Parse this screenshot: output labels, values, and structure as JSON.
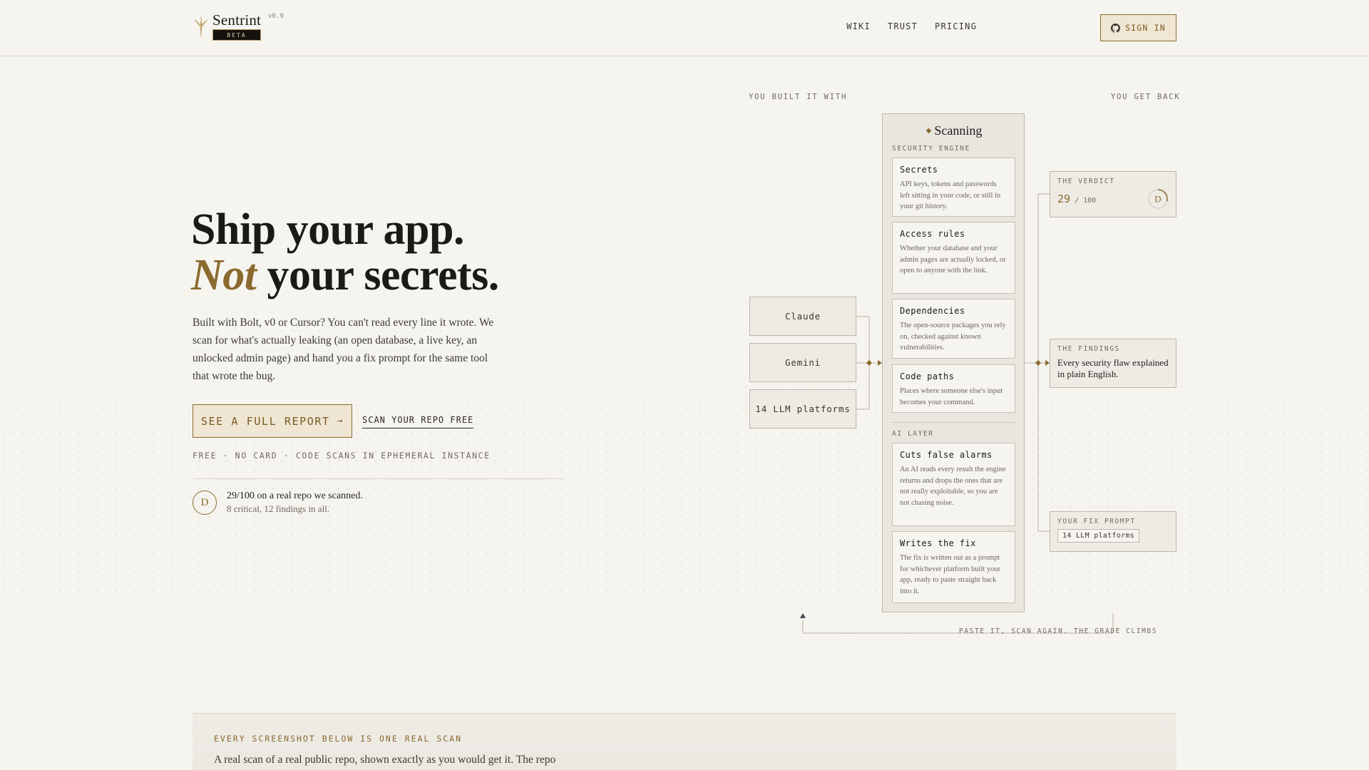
{
  "brand": {
    "name": "Sentrint",
    "version": "v0.9",
    "badge": "BETA"
  },
  "nav": {
    "items": [
      "WIKI",
      "TRUST",
      "PRICING"
    ],
    "signin_label": "SIGN IN"
  },
  "hero": {
    "headline_line1": "Ship your app.",
    "headline_emph": "Not",
    "headline_line2_rest": " your secrets.",
    "lead": "Built with Bolt, v0 or Cursor? You can't read every line it wrote. We scan for what's actually leaking (an open database, a live key, an unlocked admin page) and hand you a fix prompt for the same tool that wrote the bug.",
    "cta_primary": "SEE A FULL REPORT",
    "cta_primary_arrow": "→",
    "cta_secondary": "SCAN YOUR REPO FREE",
    "smallprint": "FREE · NO CARD · CODE SCANS IN EPHEMERAL INSTANCE",
    "grade_letter": "D",
    "grade_score": "29/100",
    "grade_text": " on a real repo we scanned.",
    "grade_detail": "8 critical, 12 findings in all."
  },
  "diagram": {
    "left_label": "YOU BUILT IT WITH",
    "right_label": "YOU GET BACK",
    "sources": [
      "Claude",
      "Gemini",
      "14 LLM platforms"
    ],
    "engine": {
      "title": "Scanning",
      "section1": "SECURITY ENGINE",
      "section2": "AI LAYER",
      "cards": [
        {
          "title": "Secrets",
          "text": "API keys, tokens and passwords left sitting in your code, or still in your git history."
        },
        {
          "title": "Access rules",
          "text": "Whether your database and your admin pages are actually locked, or open to anyone with the link."
        },
        {
          "title": "Dependencies",
          "text": "The open-source packages you rely on, checked against known vulnerabilities."
        },
        {
          "title": "Code paths",
          "text": "Places where someone else's input becomes your command."
        },
        {
          "title": "Cuts false alarms",
          "text": "An AI reads every result the engine returns and drops the ones that are not really exploitable, so you are not chasing noise."
        },
        {
          "title": "Writes the fix",
          "text": "The fix is written out as a prompt for whichever platform built your app, ready to paste straight back into it."
        }
      ]
    },
    "outputs": {
      "verdict_label": "THE VERDICT",
      "verdict_score": "29",
      "verdict_total": "/ 100",
      "verdict_grade": "D",
      "verdict_fraction": 0.29,
      "findings_label": "THE FINDINGS",
      "findings_text": "Every security flaw explained in plain English.",
      "fix_label": "YOUR FIX PROMPT",
      "fix_chip": "14 LLM platforms"
    },
    "loop_text": "PASTE IT, SCAN AGAIN. THE GRADE CLIMBS"
  },
  "proof": {
    "kicker": "EVERY SCREENSHOT BELOW IS ONE REAL SCAN",
    "text": "A real scan of a real public repo, shown exactly as you would get it. The repo"
  },
  "colors": {
    "accent": "#8a6a2e",
    "background": "#f6f4ef",
    "ink": "#1c1a17"
  }
}
